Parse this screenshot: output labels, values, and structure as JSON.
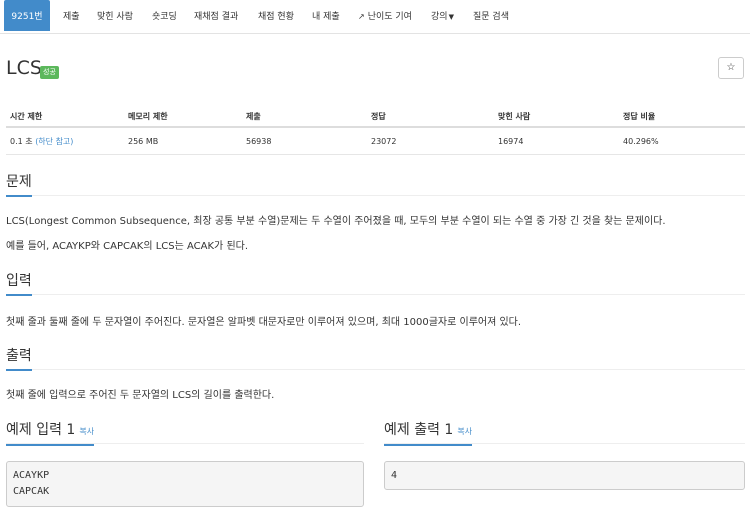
{
  "nav": {
    "items": [
      {
        "label": "9251번",
        "active": true
      },
      {
        "label": "제출"
      },
      {
        "label": "맞힌 사람"
      },
      {
        "label": "숏코딩"
      },
      {
        "label": "재채점 결과"
      },
      {
        "label": "채점 현황"
      },
      {
        "label": "내 제출"
      },
      {
        "label": "난이도 기여",
        "icon": "external-link-icon"
      },
      {
        "label": "강의",
        "dropdown": true
      },
      {
        "label": "질문 검색"
      }
    ]
  },
  "problem": {
    "title": "LCS",
    "badge": "성공",
    "star_icon": "☆"
  },
  "info": {
    "headers": [
      "시간 제한",
      "메모리 제한",
      "제출",
      "정답",
      "맞힌 사람",
      "정답 비율"
    ],
    "time": "0.1 초",
    "time_note": "(하단 참고)",
    "memory": "256 MB",
    "submissions": "56938",
    "accepted": "23072",
    "solvers": "16974",
    "ratio": "40.296%"
  },
  "sections": {
    "problem_heading": "문제",
    "problem_text_1": "LCS(Longest Common Subsequence, 최장 공통 부분 수열)문제는 두 수열이 주어졌을 때, 모두의 부분 수열이 되는 수열 중 가장 긴 것을 찾는 문제이다.",
    "problem_text_2": "예를 들어, ACAYKP와 CAPCAK의 LCS는 ACAK가 된다.",
    "input_heading": "입력",
    "input_text": "첫째 줄과 둘째 줄에 두 문자열이 주어진다. 문자열은 알파벳 대문자로만 이루어져 있으며, 최대 1000글자로 이루어져 있다.",
    "output_heading": "출력",
    "output_text": "첫째 줄에 입력으로 주어진 두 문자열의 LCS의 길이를 출력한다."
  },
  "samples": {
    "input_heading": "예제 입력 1",
    "output_heading": "예제 출력 1",
    "copy_label": "복사",
    "input_value": "ACAYKP\nCAPCAK",
    "output_value": "4"
  },
  "colors": {
    "accent": "#428bca",
    "success": "#5cb85c"
  }
}
